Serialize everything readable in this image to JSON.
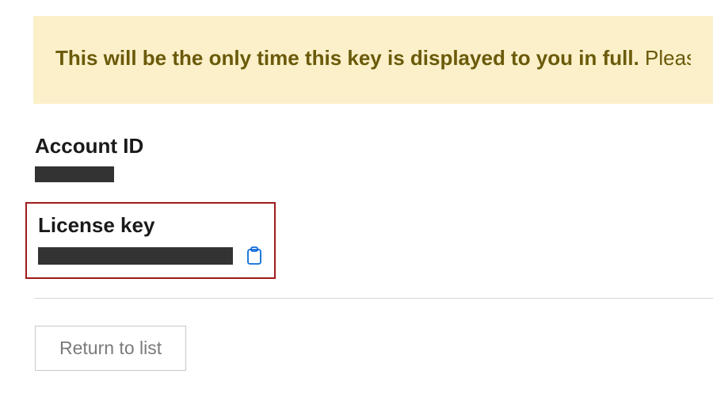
{
  "alert": {
    "bold_text": "This will be the only time this key is displayed to you in full.",
    "normal_text": " Please be sure to copy it somewhere for your reference."
  },
  "account": {
    "label": "Account ID",
    "value_redacted": true
  },
  "license": {
    "label": "License key",
    "value_redacted": true,
    "copy_icon": "clipboard-icon"
  },
  "actions": {
    "return_label": "Return to list"
  }
}
